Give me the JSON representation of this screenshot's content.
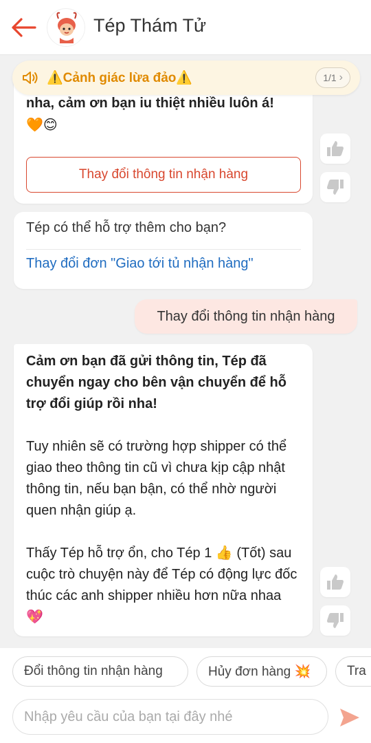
{
  "header": {
    "title": "Tép Thám Tử",
    "back_icon": "arrow-left-icon",
    "accent_color": "#e8462e"
  },
  "banner": {
    "text": "⚠️Cảnh giác lừa đảo⚠️",
    "pager": "1/1",
    "icon": "speaker-icon",
    "color": "#e08a00"
  },
  "messages": {
    "bot1_text": "Thấy hài lòng thì cho Tép xin 1 👍 (Tốt) nha, cảm ơn bạn iu thiệt nhiều luôn á! 🧡😊",
    "bot1_button": "Thay đổi thông tin nhận hàng",
    "bot2_question": "Tép có thể hỗ trợ thêm cho bạn?",
    "bot2_link": "Thay đổi đơn \"Giao tới tủ nhận hàng\"",
    "user_text": "Thay đổi thông tin nhận hàng",
    "bot3_bold": "Cảm ơn bạn đã gửi thông tin, Tép đã chuyển ngay cho bên vận chuyển để hỗ trợ đổi giúp rồi nha!",
    "bot3_p2": "Tuy nhiên sẽ có trường hợp shipper có thể giao theo thông tin cũ vì chưa kịp cập nhật thông tin, nếu bạn bận, có thể nhờ người quen nhận giúp ạ.",
    "bot3_p3": "Thấy Tép hỗ trợ ổn, cho Tép 1 👍 (Tốt) sau cuộc trò chuyện này để Tép có động lực đốc thúc các anh shipper nhiều hơn nữa nhaa 💖"
  },
  "quick_replies": [
    "Đổi thông tin nhận hàng",
    "Hủy đơn hàng 💥",
    "Tra"
  ],
  "input": {
    "placeholder": "Nhập yêu cầu của bạn tại đây nhé",
    "value": ""
  },
  "colors": {
    "user_bubble": "#fde7e2",
    "link": "#1f6cc0",
    "banner_bg": "#fdf5e2"
  }
}
